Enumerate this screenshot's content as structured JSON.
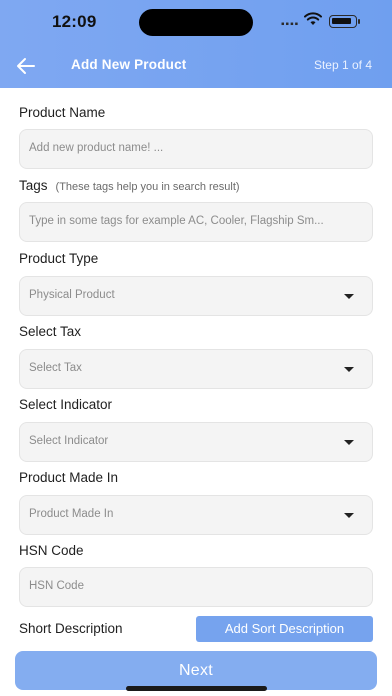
{
  "status_bar": {
    "time": "12:09",
    "signal_dots": "▪▪▪▪"
  },
  "header": {
    "title": "Add New Product",
    "step": "Step 1 of 4"
  },
  "form": {
    "product_name": {
      "label": "Product Name",
      "placeholder": "Add new product name! ..."
    },
    "tags": {
      "label": "Tags",
      "hint": "(These tags help you in search result)",
      "placeholder": "Type in some tags for example AC, Cooler, Flagship Sm..."
    },
    "product_type": {
      "label": "Product Type",
      "value": "Physical Product"
    },
    "tax": {
      "label": "Select Tax",
      "value": "Select Tax"
    },
    "indicator": {
      "label": "Select Indicator",
      "value": "Select Indicator"
    },
    "made_in": {
      "label": "Product Made In",
      "value": "Product Made In"
    },
    "hsn": {
      "label": "HSN Code",
      "placeholder": "HSN Code"
    },
    "short_description": {
      "label": "Short Description",
      "button": "Add Sort Description"
    }
  },
  "footer": {
    "next_label": "Next"
  }
}
